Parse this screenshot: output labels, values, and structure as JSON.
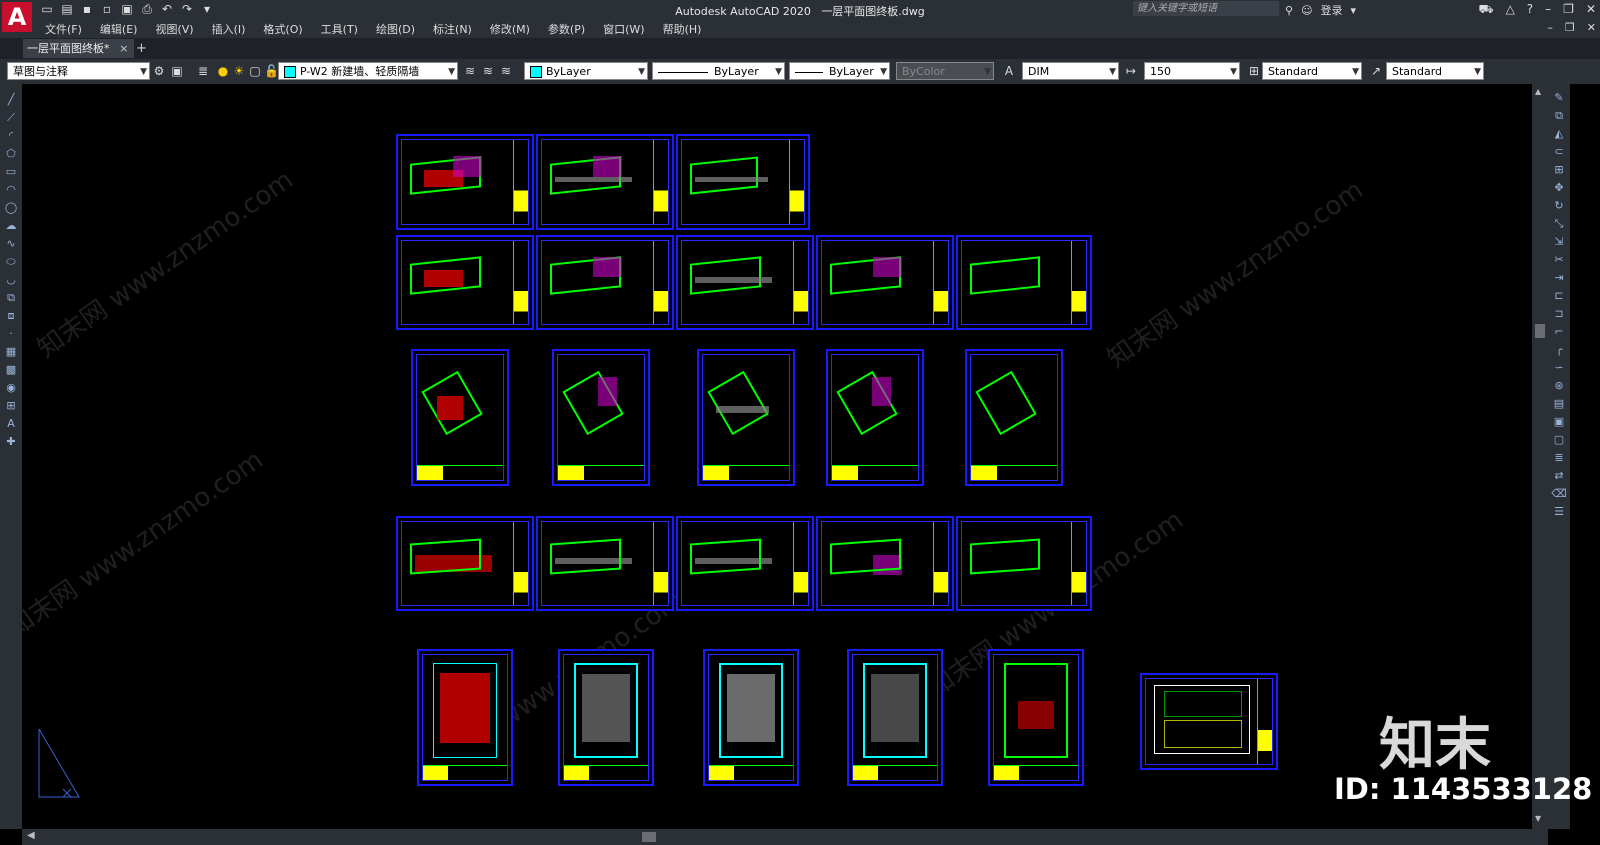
{
  "app": {
    "title": "Autodesk AutoCAD 2020",
    "filename": "一层平面图终板.dwg",
    "logo": "A"
  },
  "menu": [
    "文件(F)",
    "编辑(E)",
    "视图(V)",
    "插入(I)",
    "格式(O)",
    "工具(T)",
    "绘图(D)",
    "标注(N)",
    "修改(M)",
    "参数(P)",
    "窗口(W)",
    "帮助(H)"
  ],
  "search": {
    "placeholder": "键入关键字或短语"
  },
  "account": {
    "login": "登录"
  },
  "tabs": {
    "file_tab": "一层平面图终板*",
    "close": "×",
    "add": "+"
  },
  "toolbar": {
    "workspace": "草图与注释",
    "layer": "P-W2 新建墙、轻质隔墙",
    "color": "ByLayer",
    "linetype": "ByLayer",
    "lineweight": "ByLayer",
    "plotstyle": "ByColor",
    "dimstyle": "DIM",
    "scale": "150",
    "textstyle": "Standard",
    "tablestyle": "Standard"
  },
  "brand": {
    "logo_text": "知末",
    "id_text": "ID: 1143533128",
    "watermark_text": "知末网 www.znzmo.com"
  },
  "colors": {
    "background": "#000000",
    "sheet_border": "#1a1aff",
    "plan_lines": "#00ff00",
    "accent": "#c8102e"
  },
  "icons": {
    "left": [
      "line-icon",
      "polyline-icon",
      "arc-icon",
      "polygon-icon",
      "rectangle-icon",
      "arc2-icon",
      "circle-icon",
      "cloud-icon",
      "spline-icon",
      "ellipse-icon",
      "ellipse-arc-icon",
      "insert-block-icon",
      "make-block-icon",
      "point-icon",
      "hatch-icon",
      "gradient-icon",
      "region-icon",
      "table-icon",
      "mtext-icon",
      "add-selected-icon"
    ],
    "right": [
      "erase-icon",
      "copy-icon",
      "mirror-icon",
      "offset-icon",
      "array-icon",
      "move-icon",
      "rotate-icon",
      "scale-icon",
      "stretch-icon",
      "trim-icon",
      "extend-icon",
      "break-icon",
      "join-icon",
      "chamfer-icon",
      "fillet-icon",
      "blend-icon",
      "explode-icon",
      "draworder-icon",
      "bring-front-icon",
      "send-back-icon",
      "layer-icon",
      "match-icon",
      "purge-icon",
      "properties-icon"
    ]
  }
}
